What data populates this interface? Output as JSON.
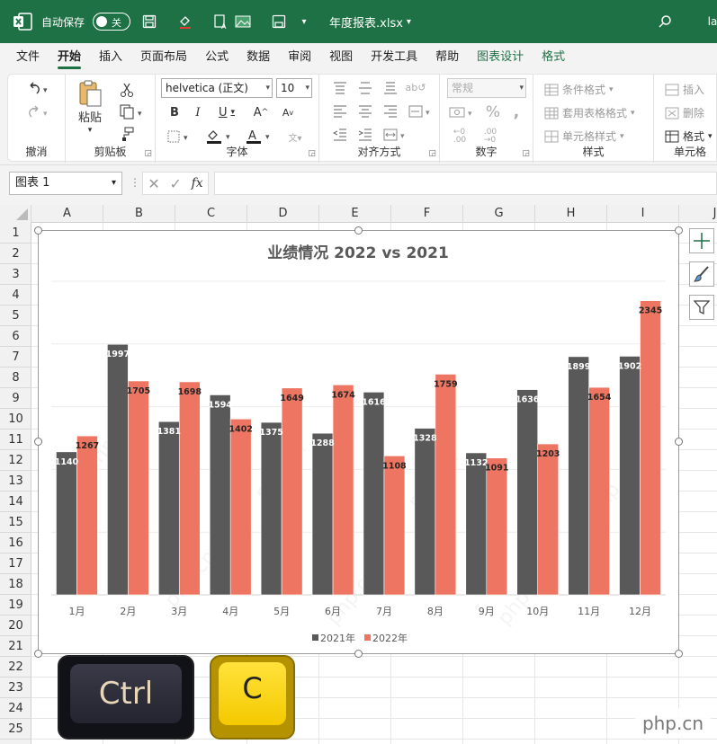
{
  "titlebar": {
    "autosave_label": "自动保存",
    "autosave_state": "关",
    "filename": "年度报表.xlsx",
    "user_initial": "la"
  },
  "tabs": [
    "文件",
    "开始",
    "插入",
    "页面布局",
    "公式",
    "数据",
    "审阅",
    "视图",
    "开发工具",
    "帮助",
    "图表设计",
    "格式"
  ],
  "ribbon": {
    "undo_group": "撤消",
    "clipboard_group": "剪贴板",
    "paste_label": "粘贴",
    "font_name": "helvetica (正文)",
    "font_size": "10",
    "font_group": "字体",
    "align_group": "对齐方式",
    "number_format": "常规",
    "number_group": "数字",
    "styles": {
      "conditional": "条件格式",
      "table": "套用表格格式",
      "cell_styles": "单元格样式",
      "group": "样式"
    },
    "cells": {
      "insert": "插入",
      "delete": "删除",
      "format": "格式",
      "group": "单元格"
    }
  },
  "formula_bar": {
    "name_box": "图表 1",
    "fx": "fx",
    "content": ""
  },
  "grid": {
    "columns": [
      "A",
      "B",
      "C",
      "D",
      "E",
      "F",
      "G",
      "H",
      "I",
      "J"
    ],
    "rows": [
      "1",
      "2",
      "3",
      "4",
      "5",
      "6",
      "7",
      "8",
      "9",
      "10",
      "11",
      "12",
      "13",
      "14",
      "15",
      "16",
      "17",
      "18",
      "19",
      "20",
      "21",
      "22",
      "23",
      "24",
      "25"
    ]
  },
  "chart_data": {
    "type": "bar",
    "title": "业绩情况 2022 vs 2021",
    "categories": [
      "1月",
      "2月",
      "3月",
      "4月",
      "5月",
      "6月",
      "7月",
      "8月",
      "9月",
      "10月",
      "11月",
      "12月"
    ],
    "series": [
      {
        "name": "2021年",
        "color": "#595959",
        "values": [
          1140,
          1997,
          1381,
          1594,
          1375,
          1288,
          1616,
          1328,
          1132,
          1636,
          1899,
          1902
        ]
      },
      {
        "name": "2022年",
        "color": "#ed7561",
        "values": [
          1267,
          1705,
          1698,
          1402,
          1649,
          1674,
          1108,
          1759,
          1091,
          1203,
          1654,
          2345
        ]
      }
    ],
    "ylim": [
      0,
      2500
    ],
    "grid": true,
    "legend": "bottom",
    "data_labels": true
  },
  "keys": {
    "ctrl": "Ctrl",
    "c": "C"
  },
  "watermark": "php.cn"
}
